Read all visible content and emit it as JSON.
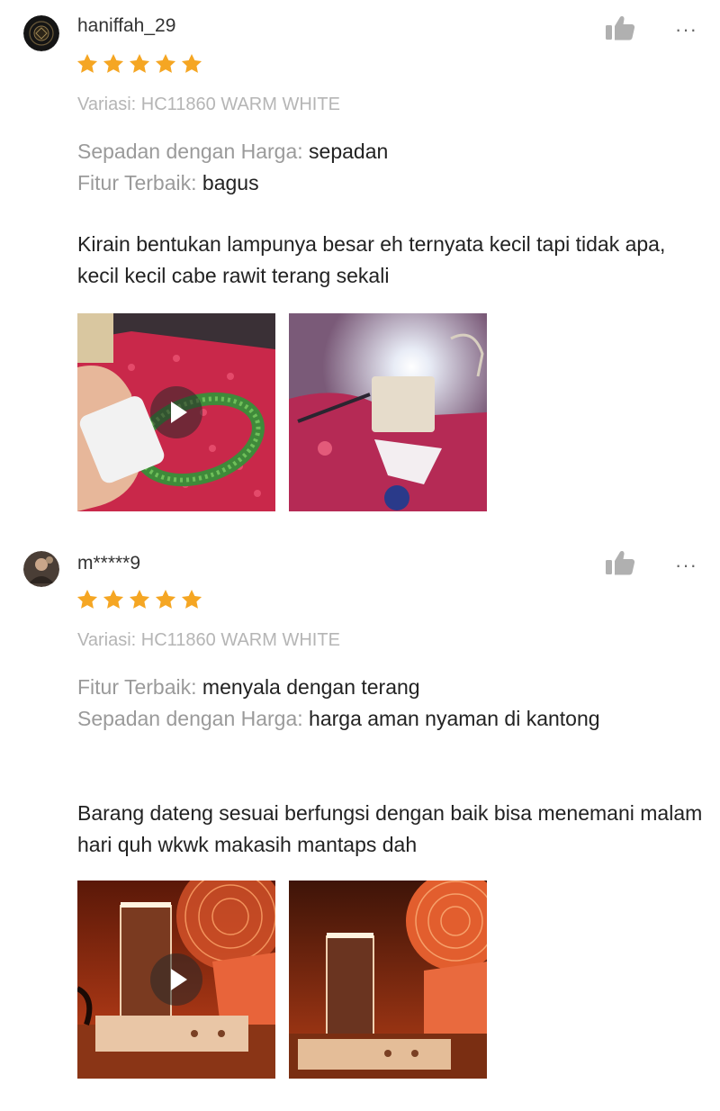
{
  "icons": {
    "star": "star-icon",
    "like": "thumbs-up-icon",
    "more": "more-dots-icon",
    "play": "play-icon"
  },
  "colors": {
    "star": "#f5a623",
    "label": "#9a9a9a",
    "variation": "#b5b5b5",
    "text": "#222222"
  },
  "reviews": [
    {
      "username": "haniffah_29",
      "rating": 5,
      "variation": "Variasi: HC11860 WARM WHITE",
      "attributes": [
        {
          "label": "Sepadan dengan Harga:",
          "value": "sepadan"
        },
        {
          "label": "Fitur Terbaik:",
          "value": "bagus"
        }
      ],
      "text": "Kirain bentukan lampunya besar eh ternyata kecil tapi tidak apa, kecil kecil cabe rawit terang sekali",
      "more": "···"
    },
    {
      "username": "m*****9",
      "rating": 5,
      "variation": "Variasi: HC11860 WARM WHITE",
      "attributes": [
        {
          "label": "Fitur Terbaik:",
          "value": "menyala dengan terang"
        },
        {
          "label": "Sepadan dengan Harga:",
          "value": "harga aman nyaman di kantong"
        }
      ],
      "text": "Barang dateng sesuai berfungsi dengan baik bisa menemani malam hari quh wkwk makasih mantaps dah",
      "more": "···"
    }
  ]
}
